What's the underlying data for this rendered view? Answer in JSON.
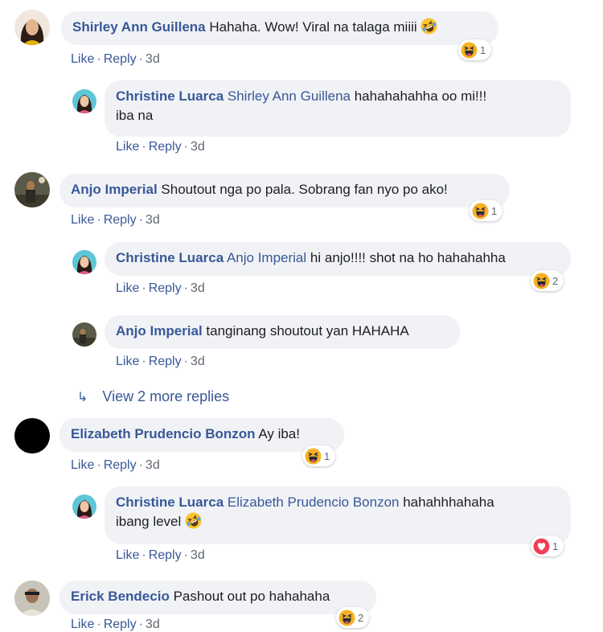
{
  "comments": [
    {
      "id": "c1",
      "author": "Shirley Ann Guillena",
      "text": "Hahaha. Wow! Viral na talaga miiii",
      "emoji": "rofl",
      "actions": {
        "like": "Like",
        "reply": "Reply",
        "time": "3d"
      },
      "reaction": {
        "type": "haha",
        "count": "1"
      }
    },
    {
      "id": "r1",
      "author": "Christine Luarca",
      "mention": "Shirley Ann Guillena",
      "text_line1": "hahahahahha oo mi!!!",
      "text_line2": "iba na",
      "actions": {
        "like": "Like",
        "reply": "Reply",
        "time": "3d"
      }
    },
    {
      "id": "c2",
      "author": "Anjo Imperial",
      "text": "Shoutout nga po pala. Sobrang fan nyo po ako!",
      "actions": {
        "like": "Like",
        "reply": "Reply",
        "time": "3d"
      },
      "reaction": {
        "type": "haha",
        "count": "1"
      }
    },
    {
      "id": "r2",
      "author": "Christine Luarca",
      "mention": "Anjo Imperial",
      "text": "hi anjo!!!! shot na ho hahahahha",
      "actions": {
        "like": "Like",
        "reply": "Reply",
        "time": "3d"
      },
      "reaction": {
        "type": "haha",
        "count": "2"
      }
    },
    {
      "id": "r3",
      "author": "Anjo Imperial",
      "text": "tanginang shoutout yan HAHAHA",
      "actions": {
        "like": "Like",
        "reply": "Reply",
        "time": "3d"
      }
    },
    {
      "id": "c3",
      "author": "Elizabeth Prudencio Bonzon",
      "text": "Ay iba!",
      "actions": {
        "like": "Like",
        "reply": "Reply",
        "time": "3d"
      },
      "reaction": {
        "type": "haha",
        "count": "1"
      }
    },
    {
      "id": "r4",
      "author": "Christine Luarca",
      "mention": "Elizabeth Prudencio Bonzon",
      "text_line1": "hahahhhahaha",
      "text_line2": "ibang level",
      "emoji": "rofl",
      "actions": {
        "like": "Like",
        "reply": "Reply",
        "time": "3d"
      },
      "reaction": {
        "type": "love",
        "count": "1"
      }
    },
    {
      "id": "c4",
      "author": "Erick Bendecio",
      "text": "Pashout out po hahahaha",
      "actions": {
        "like": "Like",
        "reply": "Reply",
        "time": "3d"
      },
      "reaction": {
        "type": "haha",
        "count": "2"
      }
    }
  ],
  "view_more": "View 2 more replies",
  "colors": {
    "link": "#385898",
    "bubble": "#f0f2f5",
    "meta": "#606770",
    "haha": "#f7b125",
    "love": "#f33e58"
  }
}
